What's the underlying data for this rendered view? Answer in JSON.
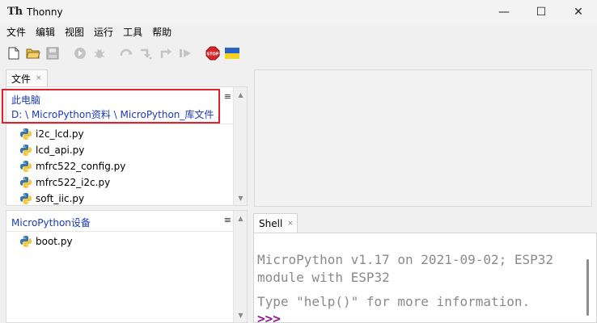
{
  "window": {
    "title": "Thonny",
    "logo_text": "Th",
    "controls": {
      "minimize": "—",
      "maximize": "☐",
      "close": "✕"
    }
  },
  "menu": [
    "文件",
    "编辑",
    "视图",
    "运行",
    "工具",
    "帮助"
  ],
  "toolbar": {
    "buttons": [
      "new-file",
      "open-file",
      "save-file",
      "run",
      "debug",
      "step-over",
      "step-into",
      "step-out",
      "resume",
      "stop",
      "ukraine-flag"
    ]
  },
  "files_panel": {
    "tab_label": "文件",
    "tab_close": "×",
    "local": {
      "title": "此电脑",
      "path": "D: \\ MicroPython资料 \\ MicroPython_库文件",
      "menu_icon": "≡",
      "files": [
        "i2c_lcd.py",
        "lcd_api.py",
        "mfrc522_config.py",
        "mfrc522_i2c.py",
        "soft_iic.py"
      ]
    },
    "device": {
      "title": "MicroPython设备",
      "menu_icon": "≡",
      "files": [
        "boot.py"
      ]
    }
  },
  "shell": {
    "tab_label": "Shell",
    "tab_close": "×",
    "lines": [
      "MicroPython v1.17 on 2021-09-02; ESP32",
      "module with ESP32",
      "Type \"help()\" for more information."
    ],
    "prompt": ">>>"
  },
  "colors": {
    "path_blue": "#1a3bbd",
    "highlight_red": "#e0202a",
    "shell_text": "#8a8a8a",
    "prompt_purple": "#8b1a8e",
    "stop_red": "#d7262b"
  }
}
